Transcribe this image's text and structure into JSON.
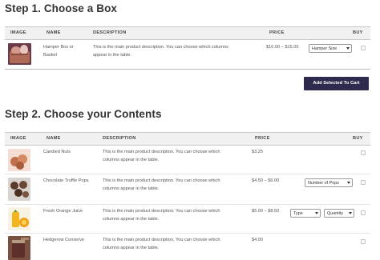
{
  "step1": {
    "title": "Step 1. Choose a Box",
    "headers": {
      "image": "IMAGE",
      "name": "NAME",
      "description": "DESCRIPTION",
      "price": "PRICE",
      "buy": "BUY"
    },
    "rows": [
      {
        "name_line1": "Hamper Box or",
        "name_line2": "Basket",
        "desc_line1": "This is the main product description. You can choose which columns",
        "desc_line2": "appear in the table.",
        "price": "$10.00 – $15.00",
        "select_label": "Hamper Size"
      }
    ],
    "add_button": "Add Selected To Cart"
  },
  "step2": {
    "title": "Step 2. Choose your Contents",
    "headers": {
      "image": "IMAGE",
      "name": "NAME",
      "description": "DESCRIPTION",
      "price": "PRICE",
      "buy": "BUY"
    },
    "rows": [
      {
        "name": "Candied Nuts",
        "desc_line1": "This is the main product description. You can choose which",
        "desc_line2": "columns appear in the table.",
        "price": "$3.25"
      },
      {
        "name": "Chocolate Truffle Pops",
        "desc_line1": "This is the main product description. You can choose which",
        "desc_line2": "columns appear in the table.",
        "price": "$4.50 – $6.00",
        "select_label": "Number of Pops"
      },
      {
        "name": "Fresh Orange Juice",
        "desc_line1": "This is the main product description. You can choose which",
        "desc_line2": "columns appear in the table.",
        "price": "$5.00 – $8.50",
        "select1_label": "Type",
        "select2_label": "Quantity"
      },
      {
        "name": "Hedgerow Conserve",
        "desc_line1": "This is the main product description. You can choose which",
        "desc_line2": "columns appear in the table.",
        "price": "$4.00"
      }
    ]
  },
  "colors": {
    "button_bg": "#2e2a4d",
    "header_bg": "#f1f1f1"
  },
  "icons": [
    "chevron-down-icon",
    "checkbox-icon"
  ]
}
